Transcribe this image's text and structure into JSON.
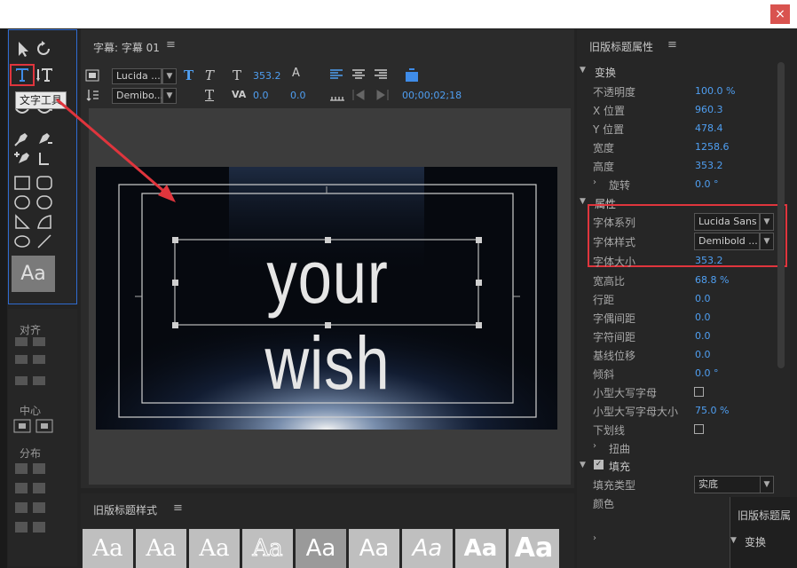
{
  "close_glyph": "×",
  "tools": {
    "tooltip": "文字工具",
    "style_preview": "Aa",
    "align_label": "对齐",
    "center_label": "中心",
    "distribute_label": "分布"
  },
  "center": {
    "tab_title": "字幕: 字幕 01",
    "menu_glyph": "≡",
    "font_family": "Lucida ...",
    "font_style": "Demibo...",
    "font_size": "353.2",
    "kerning": "0.0",
    "leading": "0.0",
    "timecode": "00;00;02;18",
    "canvas_text": "your wish"
  },
  "styles": {
    "title": "旧版标题样式",
    "menu_glyph": "≡",
    "swatches": [
      "Aa",
      "Aa",
      "Aa",
      "Aa",
      "Aa",
      "Aa",
      "Aa",
      "Aa",
      "Aa"
    ]
  },
  "props": {
    "title": "旧版标题属性",
    "menu_glyph": "≡",
    "transform_label": "变换",
    "opacity": {
      "label": "不透明度",
      "value": "100.0 %"
    },
    "x": {
      "label": "X 位置",
      "value": "960.3"
    },
    "y": {
      "label": "Y 位置",
      "value": "478.4"
    },
    "width": {
      "label": "宽度",
      "value": "1258.6"
    },
    "height": {
      "label": "高度",
      "value": "353.2"
    },
    "rotation": {
      "label": "旋转",
      "value": "0.0 °"
    },
    "props_label": "属性",
    "font_family": {
      "label": "字体系列",
      "value": "Lucida Sans"
    },
    "font_style": {
      "label": "字体样式",
      "value": "Demibold ..."
    },
    "font_size": {
      "label": "字体大小",
      "value": "353.2"
    },
    "aspect": {
      "label": "宽高比",
      "value": "68.8 %"
    },
    "leading": {
      "label": "行距",
      "value": "0.0"
    },
    "kerning": {
      "label": "字偶间距",
      "value": "0.0"
    },
    "tracking": {
      "label": "字符间距",
      "value": "0.0"
    },
    "baseline": {
      "label": "基线位移",
      "value": "0.0"
    },
    "slant": {
      "label": "倾斜",
      "value": "0.0 °"
    },
    "smallcaps": {
      "label": "小型大写字母"
    },
    "smallcaps_size": {
      "label": "小型大写字母大小",
      "value": "75.0 %"
    },
    "underline": {
      "label": "下划线"
    },
    "distort": {
      "label": "扭曲"
    },
    "fill_label": "填充",
    "fill_type": {
      "label": "填充类型",
      "value": "实底"
    },
    "color_label": "颜色"
  },
  "overlay": {
    "title": "旧版标题属",
    "transform": "变换"
  }
}
